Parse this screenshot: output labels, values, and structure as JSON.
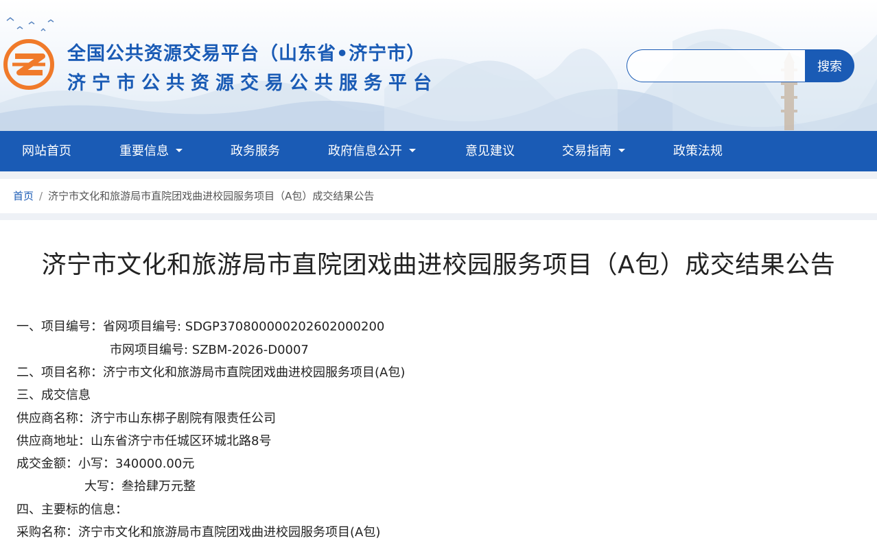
{
  "header": {
    "title_line1": "全国公共资源交易平台（山东省•济宁市）",
    "title_line2": "济宁市公共资源交易公共服务平台",
    "logo_icon": "logo-icon",
    "search": {
      "placeholder": "",
      "value": "",
      "button_label": "搜索"
    }
  },
  "colors": {
    "brand_blue": "#1a5bb5",
    "logo_orange": "#f07a2a"
  },
  "nav": {
    "items": [
      {
        "label": "网站首页",
        "has_dropdown": false
      },
      {
        "label": "重要信息",
        "has_dropdown": true
      },
      {
        "label": "政务服务",
        "has_dropdown": false
      },
      {
        "label": "政府信息公开",
        "has_dropdown": true
      },
      {
        "label": "意见建议",
        "has_dropdown": false
      },
      {
        "label": "交易指南",
        "has_dropdown": true
      },
      {
        "label": "政策法规",
        "has_dropdown": false
      }
    ]
  },
  "breadcrumb": {
    "home": "首页",
    "separator": "/",
    "current": "济宁市文化和旅游局市直院团戏曲进校园服务项目（A包）成交结果公告"
  },
  "article": {
    "title": "济宁市文化和旅游局市直院团戏曲进校园服务项目（A包）成交结果公告",
    "lines": [
      "一、项目编号：省网项目编号: SDGP370800000202602000200",
      "市网项目编号: SZBM-2026-D0007",
      "二、项目名称：济宁市文化和旅游局市直院团戏曲进校园服务项目(A包)",
      "三、成交信息",
      "供应商名称：济宁市山东梆子剧院有限责任公司",
      "供应商地址：山东省济宁市任城区环城北路8号",
      "成交金额：小写：340000.00元",
      "大写：叁拾肆万元整",
      "四、主要标的信息：",
      "采购名称：济宁市文化和旅游局市直院团戏曲进校园服务项目(A包)"
    ]
  }
}
